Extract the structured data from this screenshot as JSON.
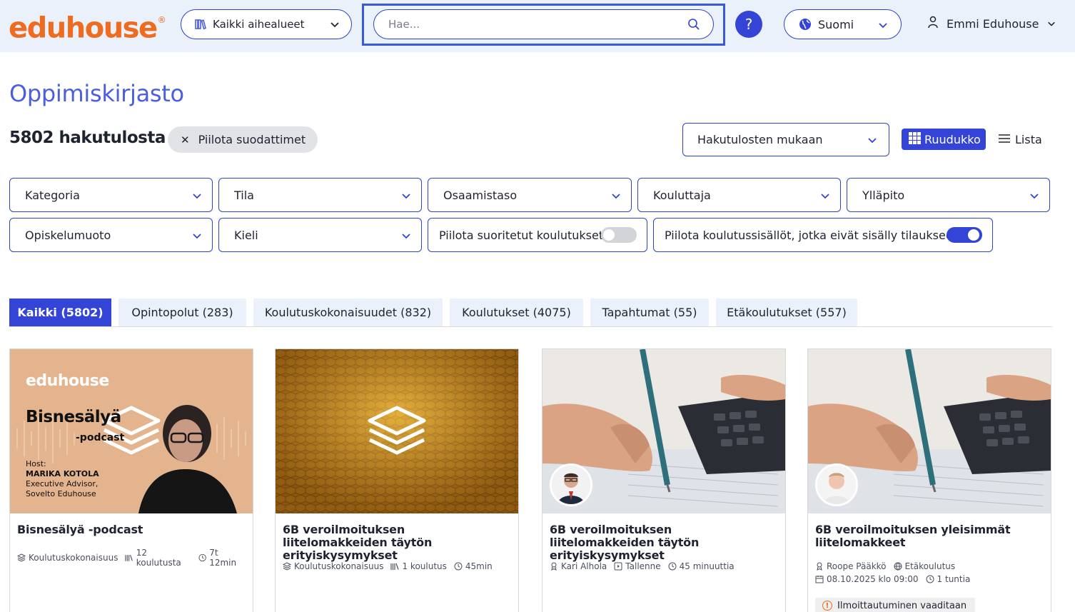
{
  "header": {
    "logo_text": "eduhouse",
    "logo_mark": "®",
    "topic_select": "Kaikki aihealueet",
    "search_placeholder": "Hae...",
    "help_label": "?",
    "language": "Suomi",
    "user_name": "Emmi Eduhouse"
  },
  "page": {
    "title": "Oppimiskirjasto",
    "result_count": "5802 hakutulosta",
    "hide_filters": "Piilota suodattimet",
    "sort": "Hakutulosten mukaan",
    "view_grid": "Ruudukko",
    "view_list": "Lista"
  },
  "filters": {
    "kategoria": "Kategoria",
    "tila": "Tila",
    "osaamistaso": "Osaamistaso",
    "kouluttaja": "Kouluttaja",
    "yllapito": "Ylläpito",
    "opiskelumuoto": "Opiskelumuoto",
    "kieli": "Kieli",
    "hide_completed": "Piilota suoritetut koulutukset",
    "hide_not_subscribed": "Piilota koulutussisällöt, jotka eivät sisälly tilaukseeni"
  },
  "toggles": {
    "hide_completed": false,
    "hide_not_subscribed": true
  },
  "tabs": [
    "Kaikki (5802)",
    "Opintopolut (283)",
    "Koulutuskokonaisuudet (832)",
    "Koulutukset (4075)",
    "Tapahtumat (55)",
    "Etäkoulutukset (557)"
  ],
  "cards": [
    {
      "title": "Bisnesälyä -podcast",
      "thumb_brand": "eduhouse",
      "thumb_title": "Bisnesälyä",
      "thumb_sub": "-podcast",
      "thumb_host_label": "Host:",
      "thumb_host_name": "MARIKA KOTOLA",
      "thumb_host_role": "Executive Advisor,",
      "thumb_host_org": "Sovelto Eduhouse",
      "type": "Koulutuskokonaisuus",
      "count": "12 koulutusta",
      "duration": "7t 12min"
    },
    {
      "title": "6B veroilmoituksen liitelomakkeiden täytön erityiskysymykset",
      "type": "Koulutuskokonaisuus",
      "count": "1 koulutus",
      "duration": "45min"
    },
    {
      "title": "6B veroilmoituksen liitelomakkeiden täytön erityiskysymykset",
      "trainer": "Kari Alhola",
      "format": "Tallenne",
      "duration": "45 minuuttia"
    },
    {
      "title": "6B veroilmoituksen yleisimmät liitelomakkeet",
      "trainer": "Roope Pääkkö",
      "format": "Etäkoulutus",
      "date": "08.10.2025 klo 09:00",
      "duration": "1 tuntia",
      "badge": "Ilmoittautuminen vaaditaan"
    }
  ],
  "colors": {
    "brand_orange": "#ee6b1f",
    "primary_blue": "#3344d6",
    "header_bg": "#eaf1fb"
  }
}
